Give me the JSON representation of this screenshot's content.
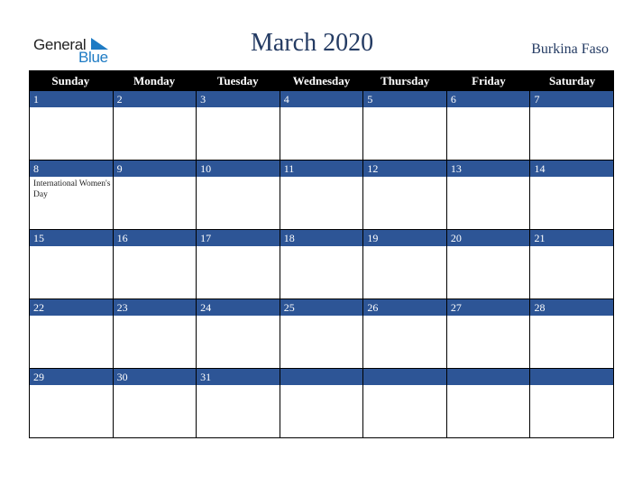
{
  "logo": {
    "line1": "General",
    "line2": "Blue",
    "icon": "triangle-flag-icon",
    "color": "#1e7bc4"
  },
  "header": {
    "title": "March 2020",
    "country": "Burkina Faso"
  },
  "colors": {
    "title": "#243b63",
    "band": "#2d5596",
    "dow_bg": "#000000"
  },
  "days_of_week": [
    "Sunday",
    "Monday",
    "Tuesday",
    "Wednesday",
    "Thursday",
    "Friday",
    "Saturday"
  ],
  "weeks": [
    [
      {
        "d": "1",
        "e": ""
      },
      {
        "d": "2",
        "e": ""
      },
      {
        "d": "3",
        "e": ""
      },
      {
        "d": "4",
        "e": ""
      },
      {
        "d": "5",
        "e": ""
      },
      {
        "d": "6",
        "e": ""
      },
      {
        "d": "7",
        "e": ""
      }
    ],
    [
      {
        "d": "8",
        "e": "International Women's Day"
      },
      {
        "d": "9",
        "e": ""
      },
      {
        "d": "10",
        "e": ""
      },
      {
        "d": "11",
        "e": ""
      },
      {
        "d": "12",
        "e": ""
      },
      {
        "d": "13",
        "e": ""
      },
      {
        "d": "14",
        "e": ""
      }
    ],
    [
      {
        "d": "15",
        "e": ""
      },
      {
        "d": "16",
        "e": ""
      },
      {
        "d": "17",
        "e": ""
      },
      {
        "d": "18",
        "e": ""
      },
      {
        "d": "19",
        "e": ""
      },
      {
        "d": "20",
        "e": ""
      },
      {
        "d": "21",
        "e": ""
      }
    ],
    [
      {
        "d": "22",
        "e": ""
      },
      {
        "d": "23",
        "e": ""
      },
      {
        "d": "24",
        "e": ""
      },
      {
        "d": "25",
        "e": ""
      },
      {
        "d": "26",
        "e": ""
      },
      {
        "d": "27",
        "e": ""
      },
      {
        "d": "28",
        "e": ""
      }
    ],
    [
      {
        "d": "29",
        "e": ""
      },
      {
        "d": "30",
        "e": ""
      },
      {
        "d": "31",
        "e": ""
      },
      {
        "d": "",
        "e": ""
      },
      {
        "d": "",
        "e": ""
      },
      {
        "d": "",
        "e": ""
      },
      {
        "d": "",
        "e": ""
      }
    ]
  ]
}
